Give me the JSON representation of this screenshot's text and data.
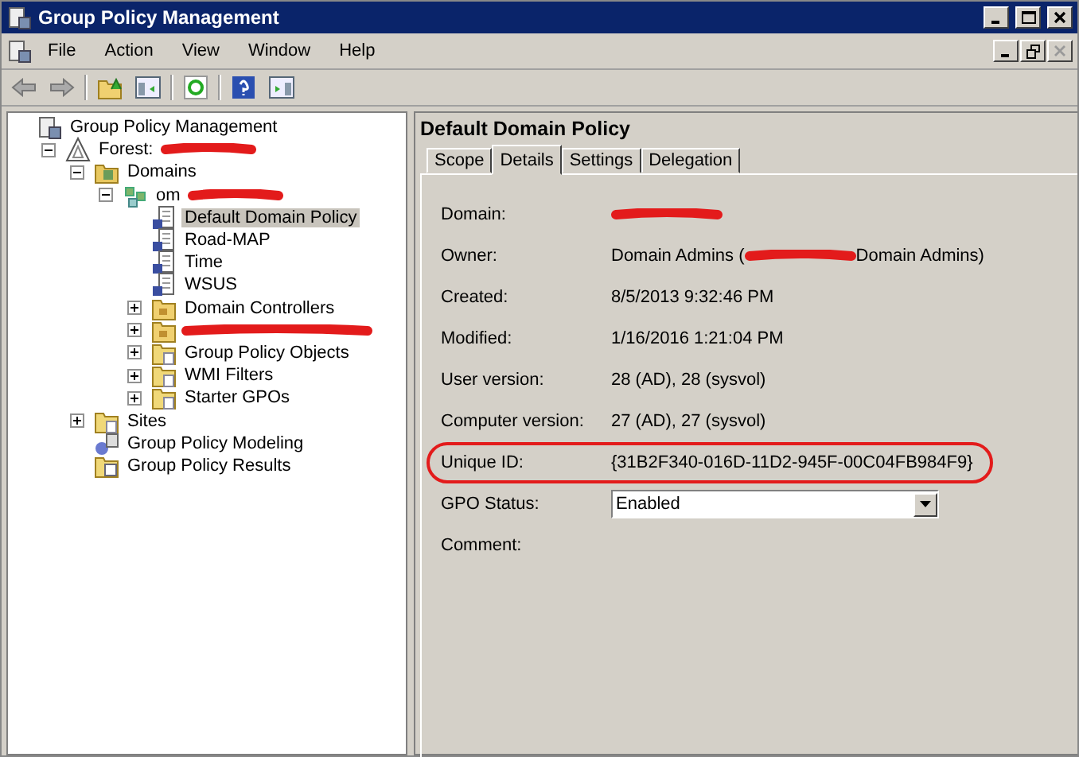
{
  "window": {
    "title": "Group Policy Management"
  },
  "menu": [
    {
      "label": "File"
    },
    {
      "label": "Action"
    },
    {
      "label": "View"
    },
    {
      "label": "Window"
    },
    {
      "label": "Help"
    }
  ],
  "tree": [
    {
      "label": "Group Policy Management",
      "kind": "console",
      "selected": false,
      "children": [
        {
          "label": "Forest:",
          "kind": "forest",
          "expanded": true,
          "selected": false,
          "redacted": true,
          "children": [
            {
              "label": "Domains",
              "kind": "domains",
              "expanded": true,
              "selected": false,
              "children": [
                {
                  "label": "om",
                  "kind": "domain",
                  "expanded": true,
                  "selected": false,
                  "redacted": true,
                  "children": [
                    {
                      "label": "Default Domain Policy",
                      "kind": "gpo",
                      "selected": true
                    },
                    {
                      "label": "Road-MAP",
                      "kind": "gpo",
                      "selected": false
                    },
                    {
                      "label": "Time",
                      "kind": "gpo",
                      "selected": false
                    },
                    {
                      "label": "WSUS",
                      "kind": "gpo",
                      "selected": false
                    },
                    {
                      "label": "Domain Controllers",
                      "kind": "ou",
                      "expanded": false,
                      "selected": false
                    },
                    {
                      "kind": "ou",
                      "expanded": false,
                      "redacted": true
                    },
                    {
                      "label": "Group Policy Objects",
                      "kind": "folder",
                      "expanded": false,
                      "selected": false
                    },
                    {
                      "label": "WMI Filters",
                      "kind": "folder",
                      "expanded": false,
                      "selected": false
                    },
                    {
                      "label": "Starter GPOs",
                      "kind": "folder",
                      "expanded": false,
                      "selected": false
                    }
                  ]
                }
              ]
            },
            {
              "label": "Sites",
              "kind": "folder",
              "expanded": false,
              "selected": false
            },
            {
              "label": "Group Policy Modeling",
              "kind": "modeling",
              "selected": false
            },
            {
              "label": "Group Policy Results",
              "kind": "results",
              "selected": false
            }
          ]
        }
      ]
    }
  ],
  "details": {
    "title": "Default Domain Policy",
    "tabs": [
      {
        "label": "Scope",
        "selected": false
      },
      {
        "label": "Details",
        "selected": true
      },
      {
        "label": "Settings",
        "selected": false
      },
      {
        "label": "Delegation",
        "selected": false
      }
    ],
    "fields": [
      {
        "label": "Domain:",
        "kind": "text",
        "redacted": true
      },
      {
        "label": "Owner:",
        "kind": "text",
        "value": "Domain Admins (",
        "value_end": "Domain Admins)",
        "redacted": true
      },
      {
        "label": "Created:",
        "kind": "text",
        "value": "8/5/2013 9:32:46 PM"
      },
      {
        "label": "Modified:",
        "kind": "text",
        "value": "1/16/2016 1:21:04 PM"
      },
      {
        "label": "User version:",
        "kind": "text",
        "value": "28 (AD), 28 (sysvol)"
      },
      {
        "label": "Computer version:",
        "kind": "text",
        "value": "27 (AD), 27 (sysvol)"
      },
      {
        "label": "Unique ID:",
        "kind": "text",
        "value": "{31B2F340-016D-11D2-945F-00C04FB984F9}",
        "circled": true
      },
      {
        "label": "GPO Status:",
        "kind": "dropdown",
        "value": "Enabled"
      },
      {
        "label": "Comment:",
        "kind": "empty"
      }
    ]
  }
}
